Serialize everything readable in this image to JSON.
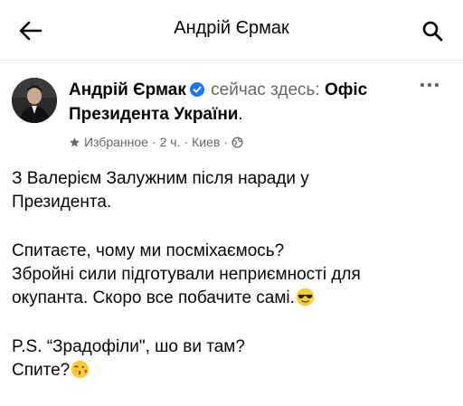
{
  "topbar": {
    "title": "Андрій Єрмак"
  },
  "post": {
    "author": "Андрій Єрмак",
    "here_text": "сейчас здесь:",
    "place_line1": "Офіс",
    "place_line2": "Президента України",
    "end_dot": ".",
    "favorites": "Избранное",
    "time": "2 ч.",
    "location": "Киев",
    "dot": "·",
    "body": {
      "p1_line1": "З Валерієм Залужним після наради у",
      "p1_line2": "Президента.",
      "p2_line1": "Спитаєте, чому ми посміхаємось?",
      "p2_line2": "Збройні сили підготували неприємності для",
      "p2_line3": "окупанта. Скоро все побачите самі.",
      "p3_line1": "P.S. “Зрадофіли\", шо ви там?",
      "p3_line2": "Спите?"
    }
  },
  "colors": {
    "meta": "#65676b",
    "verified": "#1877f2",
    "text": "#050505"
  },
  "icons": [
    "back-arrow-icon",
    "search-icon",
    "verified-badge-icon",
    "more-options-icon",
    "star-icon",
    "globe-icon",
    "sunglasses-emoji-icon",
    "kiss-emoji-icon"
  ]
}
